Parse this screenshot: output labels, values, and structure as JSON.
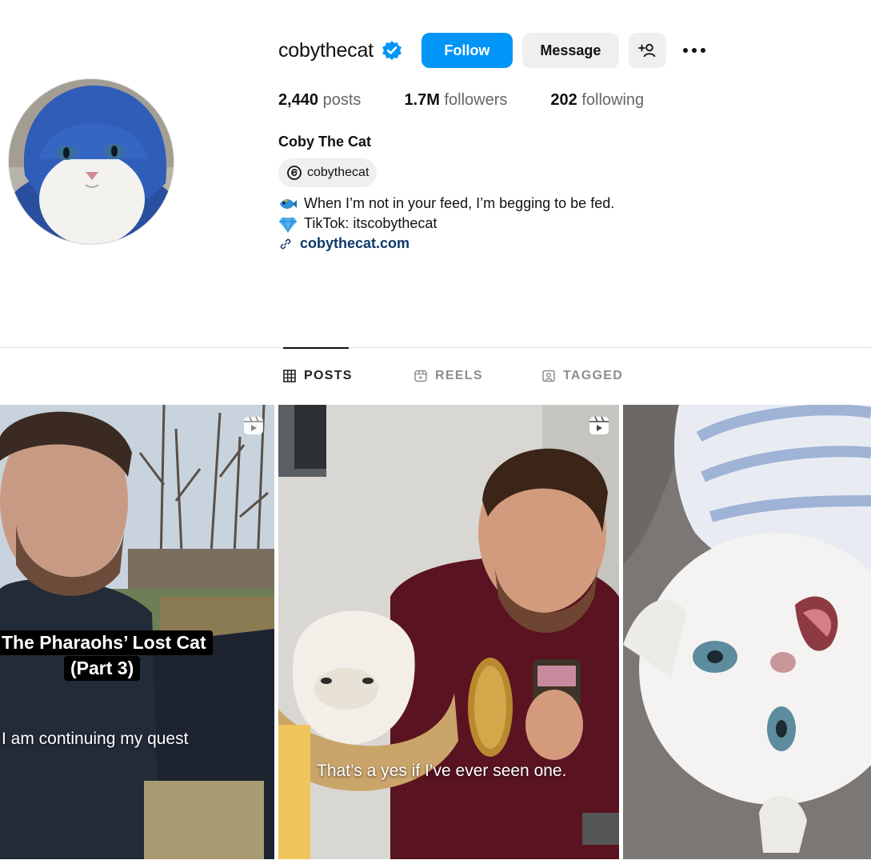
{
  "profile": {
    "username": "cobythecat",
    "verified": true,
    "follow_label": "Follow",
    "message_label": "Message",
    "more_label": "•••",
    "stats": [
      {
        "value": "2,440",
        "label": "posts"
      },
      {
        "value": "1.7M",
        "label": "followers"
      },
      {
        "value": "202",
        "label": "following"
      }
    ],
    "full_name": "Coby The Cat",
    "threads_handle": "cobythecat",
    "bio_lines": [
      "When I’m not in your feed, I’m begging to be fed.",
      "TikTok: itscobythecat"
    ],
    "website": "cobythecat.com"
  },
  "tabs": [
    {
      "label": "POSTS",
      "icon": "grid-icon",
      "active": true
    },
    {
      "label": "REELS",
      "icon": "reels-icon",
      "active": false
    },
    {
      "label": "TAGGED",
      "icon": "tagged-icon",
      "active": false
    }
  ],
  "posts": [
    {
      "type": "reel",
      "title_lines": [
        "The Pharaohs’ Lost Cat",
        "(Part 3)"
      ],
      "subtitle": "I am continuing my quest"
    },
    {
      "type": "reel",
      "subtitle": "That’s a yes if I’ve ever seen one."
    },
    {
      "type": "photo"
    }
  ],
  "colors": {
    "accent": "#0095f6",
    "verified": "#0095f6",
    "link": "#0f3a6b"
  }
}
